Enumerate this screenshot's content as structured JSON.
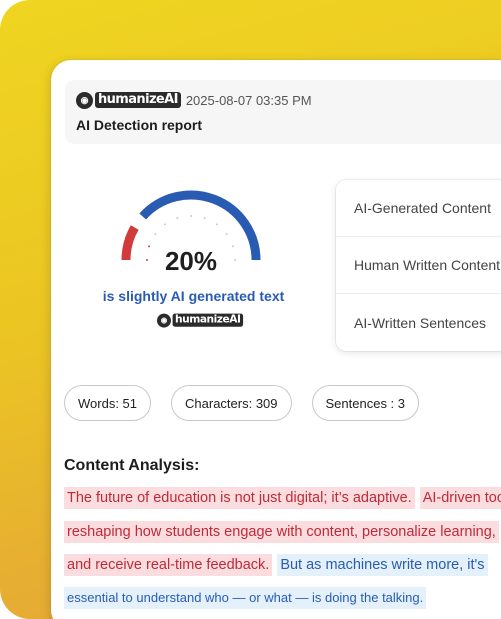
{
  "colors": {
    "accent_yellow": "#efd521",
    "ai_text": "#c02a37",
    "ai_highlight": "#fbdde0",
    "human_text": "#2a5bb3",
    "human_highlight": "#e4f1fb",
    "gauge_red": "#d23b3b",
    "gauge_blue": "#2a5bb3"
  },
  "header": {
    "brand": "humanizeAI",
    "timestamp": "2025-08-07 03:35 PM",
    "title": "AI Detection report"
  },
  "gauge": {
    "percent_label": "20%",
    "ai_fraction": 0.2,
    "verdict": "is slightly AI generated text",
    "brand": "humanizeAI"
  },
  "stats_panel": {
    "rows": [
      {
        "label": "AI-Generated Content"
      },
      {
        "label": "Human Written Content"
      },
      {
        "label": "AI-Written Sentences"
      }
    ]
  },
  "counts": {
    "words": "Words: 51",
    "characters": "Characters: 309",
    "sentences": "Sentences : 3"
  },
  "analysis": {
    "title": "Content Analysis:",
    "lines": [
      [
        {
          "type": "ai",
          "text": "The future of education is not just digital; it’s adaptive."
        },
        {
          "type": "ai",
          "text": "AI-driven tools are"
        }
      ],
      [
        {
          "type": "ai",
          "text": "reshaping how students engage with content, personalize learning,"
        }
      ],
      [
        {
          "type": "ai",
          "text": " and receive real-time feedback."
        },
        {
          "type": "human",
          "text": "But as machines write more, it's"
        }
      ],
      [
        {
          "type": "human-small",
          "text": "essential to understand who — or what — is doing the talking."
        }
      ]
    ]
  }
}
